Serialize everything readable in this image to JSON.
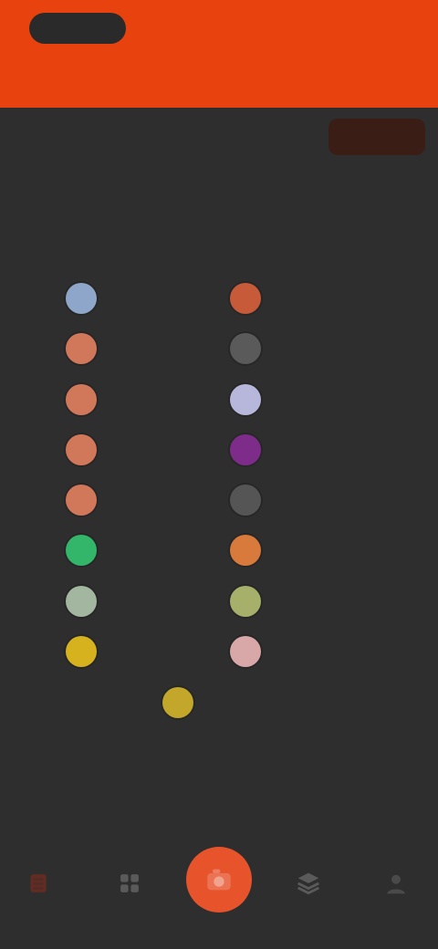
{
  "header": {
    "logo_text": "",
    "right_text": "",
    "bottom_left": "",
    "bottom_center": "",
    "bottom_right": "",
    "accent": "#e8420e"
  },
  "subheader": {
    "subtitle": "",
    "button_label": ""
  },
  "legend": {
    "items": [
      {
        "label": "",
        "color": "#8ea6c9"
      },
      {
        "label": "",
        "color": "#c65a39"
      },
      {
        "label": "",
        "color": "#d2785a"
      },
      {
        "label": "",
        "color": "#5a5a5a"
      },
      {
        "label": "",
        "color": "#d2785a"
      },
      {
        "label": "",
        "color": "#b7b7dc"
      },
      {
        "label": "",
        "color": "#d2785a"
      },
      {
        "label": "",
        "color": "#7e2c8a"
      },
      {
        "label": "",
        "color": "#d2785a"
      },
      {
        "label": "",
        "color": "#555555"
      },
      {
        "label": "",
        "color": "#33b56a"
      },
      {
        "label": "",
        "color": "#d87a3b"
      },
      {
        "label": "",
        "color": "#a3b6a0"
      },
      {
        "label": "",
        "color": "#a6b06a"
      },
      {
        "label": "",
        "color": "#d6b21f"
      },
      {
        "label": "",
        "color": "#d8a7a7"
      },
      {
        "label": "",
        "color": "#c2a72b"
      }
    ]
  },
  "bottom_nav": {
    "items": [
      {
        "icon": "menu-icon",
        "color": "#6b2c20"
      },
      {
        "icon": "grid-icon",
        "color": "#5a5a5a"
      },
      {
        "icon": "camera-icon",
        "color": "#e7542c"
      },
      {
        "icon": "layers-icon",
        "color": "#5a5a5a"
      },
      {
        "icon": "profile-icon",
        "color": "#4a4a4a"
      }
    ]
  }
}
